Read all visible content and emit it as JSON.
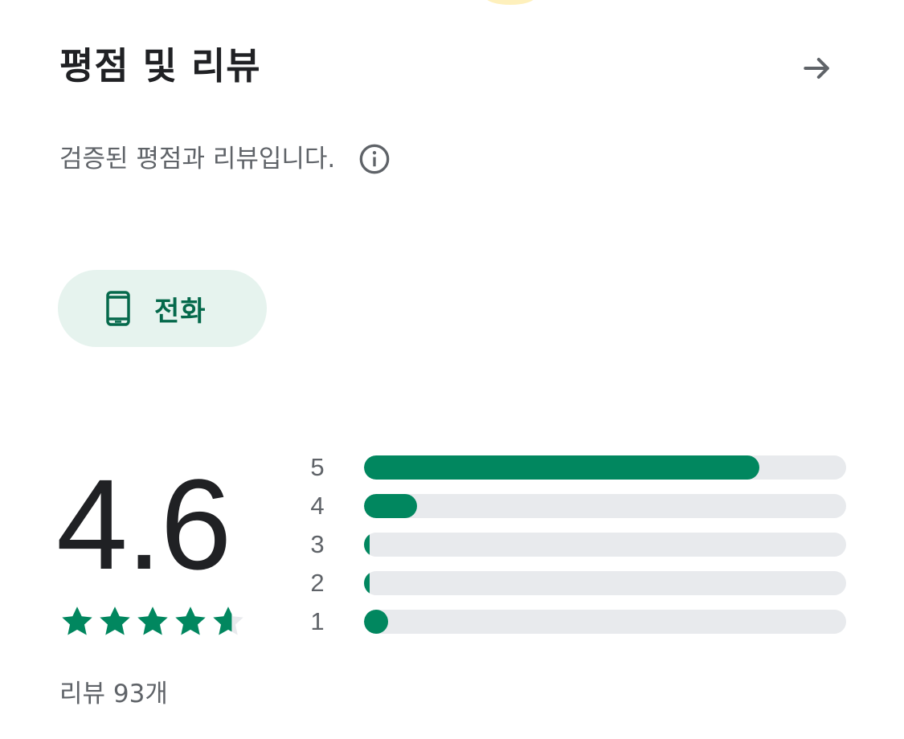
{
  "header": {
    "title": "평점 및 리뷰",
    "arrow_icon": "arrow-right-icon"
  },
  "subtitle": {
    "text": "검증된 평점과 리뷰입니다.",
    "info_icon": "info-icon"
  },
  "device_filter": {
    "label": "전화",
    "icon": "phone-icon"
  },
  "rating": {
    "score": "4.6",
    "stars_value": 4.6,
    "stars_max": 5,
    "review_count": "리뷰 93개"
  },
  "histogram": [
    {
      "label": "5",
      "fraction": 0.82
    },
    {
      "label": "4",
      "fraction": 0.11
    },
    {
      "label": "3",
      "fraction": 0.012
    },
    {
      "label": "2",
      "fraction": 0.012
    },
    {
      "label": "1",
      "fraction": 0.05
    }
  ],
  "colors": {
    "accent": "#01875f",
    "chip_bg": "#e6f3ee",
    "track": "#e8eaed",
    "star_empty": "#e8eaed"
  }
}
